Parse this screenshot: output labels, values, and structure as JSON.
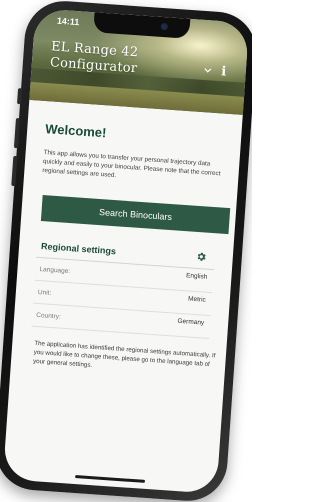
{
  "status_bar": {
    "time": "14:11"
  },
  "header": {
    "title_line1": "EL Range 42",
    "title_line2": "Configurator",
    "info_icon": "info-icon",
    "info_glyph": "i"
  },
  "welcome": {
    "title": "Welcome!",
    "body": "This app allows you to transfer your personal trajectory data quickly and easily to your binocular. Please note that the correct regional settings are used.",
    "search_button_label": "Search Binoculars"
  },
  "regional_settings": {
    "title": "Regional settings",
    "icon": "gear-icon",
    "rows": [
      {
        "label": "Language:",
        "value": "English"
      },
      {
        "label": "Unit:",
        "value": "Metric"
      },
      {
        "label": "Country:",
        "value": "Germany"
      }
    ],
    "note": "The application has identified the regional settings automatically. If you would like to change these, please go to the language tab of your general settings."
  },
  "colors": {
    "accent": "#2e5a45",
    "heading": "#1b4a37"
  }
}
